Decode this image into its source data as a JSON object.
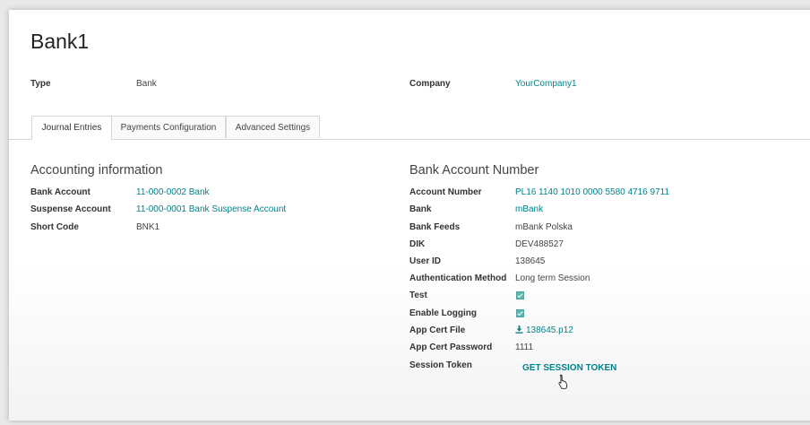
{
  "record": {
    "title": "Bank1"
  },
  "header_fields": {
    "type_label": "Type",
    "type_value": "Bank",
    "company_label": "Company",
    "company_value": "YourCompany1"
  },
  "tabs": [
    {
      "label": "Journal Entries",
      "active": true
    },
    {
      "label": "Payments Configuration",
      "active": false
    },
    {
      "label": "Advanced Settings",
      "active": false
    }
  ],
  "accounting": {
    "title": "Accounting information",
    "bank_account_label": "Bank Account",
    "bank_account_value": "11-000-0002 Bank",
    "suspense_account_label": "Suspense Account",
    "suspense_account_value": "11-000-0001 Bank Suspense Account",
    "short_code_label": "Short Code",
    "short_code_value": "BNK1"
  },
  "bank_account_number": {
    "title": "Bank Account Number",
    "account_number_label": "Account Number",
    "account_number_value": "PL16 1140 1010 0000 5580 4716 9711",
    "bank_label": "Bank",
    "bank_value": "mBank",
    "bank_feeds_label": "Bank Feeds",
    "bank_feeds_value": "mBank Polska",
    "dik_label": "DIK",
    "dik_value": "DEV488527",
    "user_id_label": "User ID",
    "user_id_value": "138645",
    "auth_method_label": "Authentication Method",
    "auth_method_value": "Long term Session",
    "test_label": "Test",
    "test_checked": true,
    "enable_logging_label": "Enable Logging",
    "enable_logging_checked": true,
    "app_cert_file_label": "App Cert File",
    "app_cert_file_value": "138645.p12",
    "app_cert_password_label": "App Cert Password",
    "app_cert_password_value": "1111",
    "session_token_label": "Session Token",
    "session_token_button": "GET SESSION TOKEN"
  },
  "colors": {
    "link": "#00828a",
    "checkbox": "#5fb6b0",
    "background": "#e9e9e9"
  },
  "icons": {
    "download": "download-icon",
    "cursor": "hand-pointer-icon",
    "checkbox": "checkbox-checked-icon"
  }
}
